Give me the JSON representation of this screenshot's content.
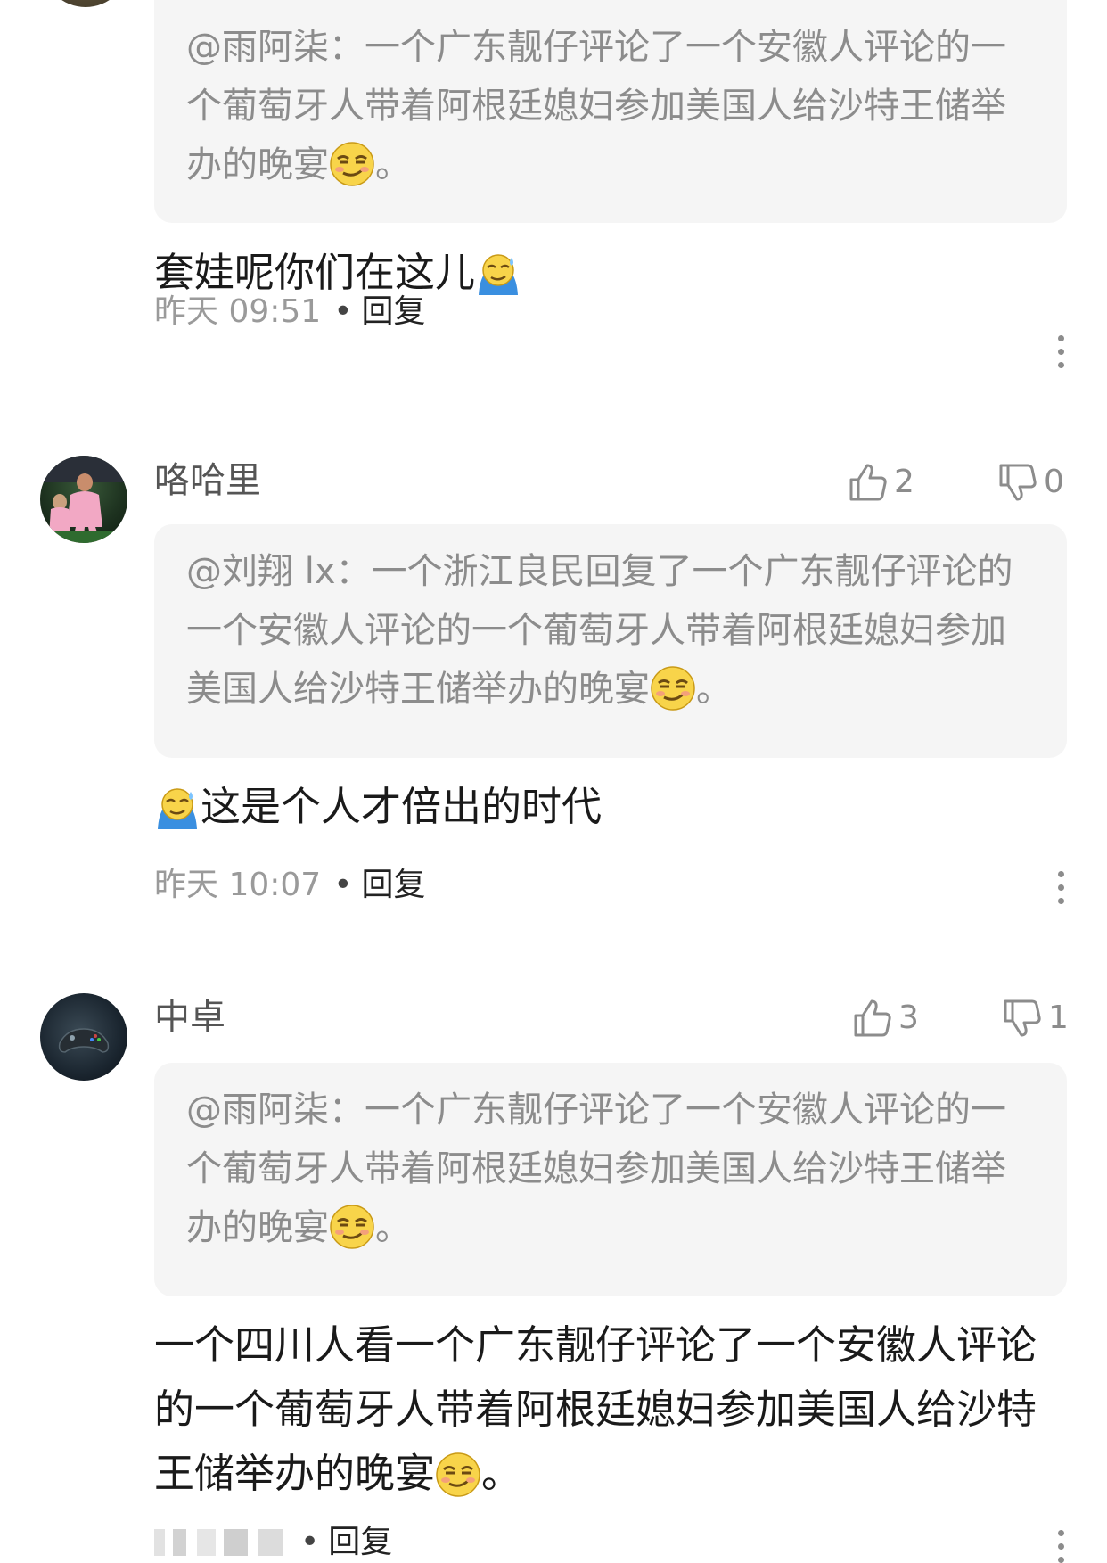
{
  "comments": [
    {
      "quote": {
        "at": "@雨阿柒",
        "sep": "：",
        "text": "一个广东靓仔评论了一个安徽人评论的一个葡萄牙人带着阿根廷媳妇参加美国人给沙特王储举办的晚宴",
        "tail": "。",
        "emoji": "smirk-emoji"
      },
      "text": "套娃呢你们在这儿",
      "text_emoji": "sweat-emoji",
      "time": "昨天 09:51",
      "reply_label": "回复"
    },
    {
      "username": "咯哈里",
      "likes": "2",
      "dislikes": "0",
      "quote": {
        "at": "@刘翔 lx",
        "sep": "：",
        "text": "一个浙江良民回复了一个广东靓仔评论的一个安徽人评论的一个葡萄牙人带着阿根廷媳妇参加美国人给沙特王储举办的晚宴",
        "tail": "。",
        "emoji": "smirk-emoji"
      },
      "text": "这是个人才倍出的时代",
      "text_emoji": "sweat-emoji",
      "time": "昨天 10:07",
      "reply_label": "回复"
    },
    {
      "username": "中卓",
      "likes": "3",
      "dislikes": "1",
      "quote": {
        "at": "@雨阿柒",
        "sep": "：",
        "text": "一个广东靓仔评论了一个安徽人评论的一个葡萄牙人带着阿根廷媳妇参加美国人给沙特王储举办的晚宴",
        "tail": "。",
        "emoji": "smirk-emoji"
      },
      "text": "一个四川人看一个广东靓仔评论了一个安徽人评论的一个葡萄牙人带着阿根廷媳妇参加美国人给沙特王储举办的晚宴",
      "tail": "。",
      "text_emoji": "smirk-emoji",
      "reply_label": "回复"
    }
  ],
  "icons": {
    "like": "thumbs-up-icon",
    "dislike": "thumbs-down-icon",
    "more": "more-vertical-icon"
  },
  "colors": {
    "background": "#ffffff",
    "quote_background": "#f5f5f5",
    "muted_text": "#8c8c8c",
    "body_text": "#1a1a1a"
  }
}
